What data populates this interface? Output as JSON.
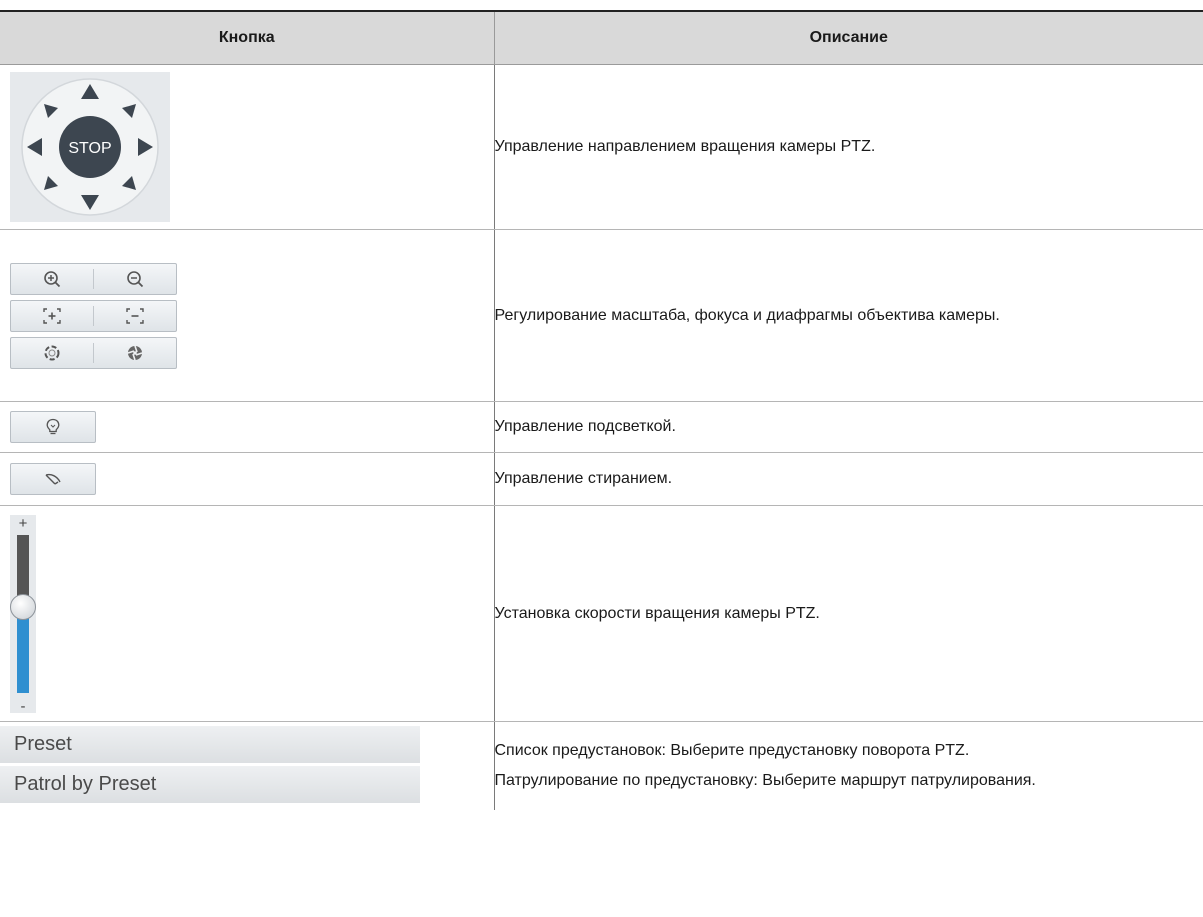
{
  "table": {
    "header_button": "Кнопка",
    "header_description": "Описание"
  },
  "rows": [
    {
      "descriptions": [
        "Управление направлением вращения камеры PTZ."
      ]
    },
    {
      "descriptions": [
        "Регулирование масштаба, фокуса и диафрагмы объектива камеры."
      ]
    },
    {
      "descriptions": [
        "Управление подсветкой."
      ]
    },
    {
      "descriptions": [
        "Управление стиранием."
      ]
    },
    {
      "descriptions": [
        "Установка скорости вращения камеры PTZ."
      ]
    },
    {
      "descriptions": [
        "Список предустановок: Выберите предустановку поворота PTZ.",
        "Патрулирование по предустановку: Выберите маршрут патрулирования."
      ]
    }
  ],
  "ptz_pad": {
    "stop_label": "STOP"
  },
  "speed_slider": {
    "plus": "+",
    "minus": "-",
    "level": 0.55
  },
  "preset_menu": {
    "items": [
      "Preset",
      "Patrol by Preset"
    ]
  },
  "icons": {
    "direction_arrows": "triangle-arrows",
    "zoom_in": "zoom-in-icon",
    "zoom_out": "zoom-out-icon",
    "focus_near": "focus-plus-icon",
    "focus_far": "focus-minus-icon",
    "iris_open": "iris-open-icon",
    "iris_close": "iris-close-icon",
    "light": "light-bulb-icon",
    "wiper": "wiper-icon"
  },
  "colors": {
    "header_bg": "#d9d9d9",
    "pad_bg": "#e6e9ec",
    "pad_center": "#3d4650",
    "slider_fill": "#2f8fd0"
  }
}
